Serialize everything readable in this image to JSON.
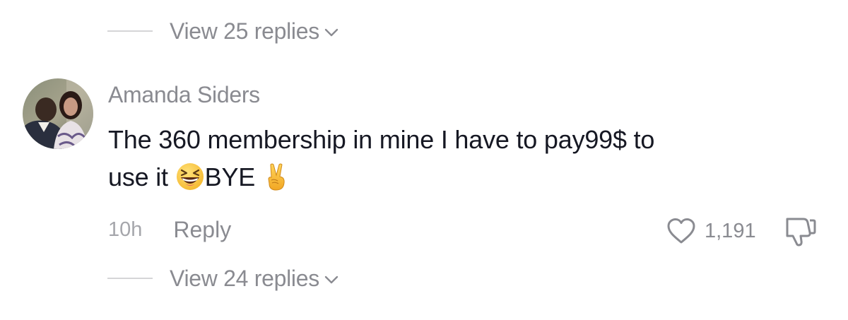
{
  "thread_above": {
    "view_replies_label": "View 25 replies"
  },
  "comment": {
    "username": "Amanda Siders",
    "text_line1": "The 360 membership in mine I have to pay99$ to",
    "text_line2_part1": "use it ",
    "text_line2_part2": "BYE ",
    "emojis": [
      "grinning-squinting-face",
      "victory-hand"
    ],
    "timestamp": "10h",
    "reply_label": "Reply",
    "like_count": "1,191",
    "view_replies_label": "View 24 replies"
  },
  "icons": {
    "chevron": "chevron-down-icon",
    "heart": "heart-icon",
    "dislike": "thumbs-down-icon"
  },
  "colors": {
    "primary_text": "#161823",
    "secondary_text": "#8a8b91",
    "muted_text": "#a5a6ab",
    "divider": "#d5d5d7"
  }
}
